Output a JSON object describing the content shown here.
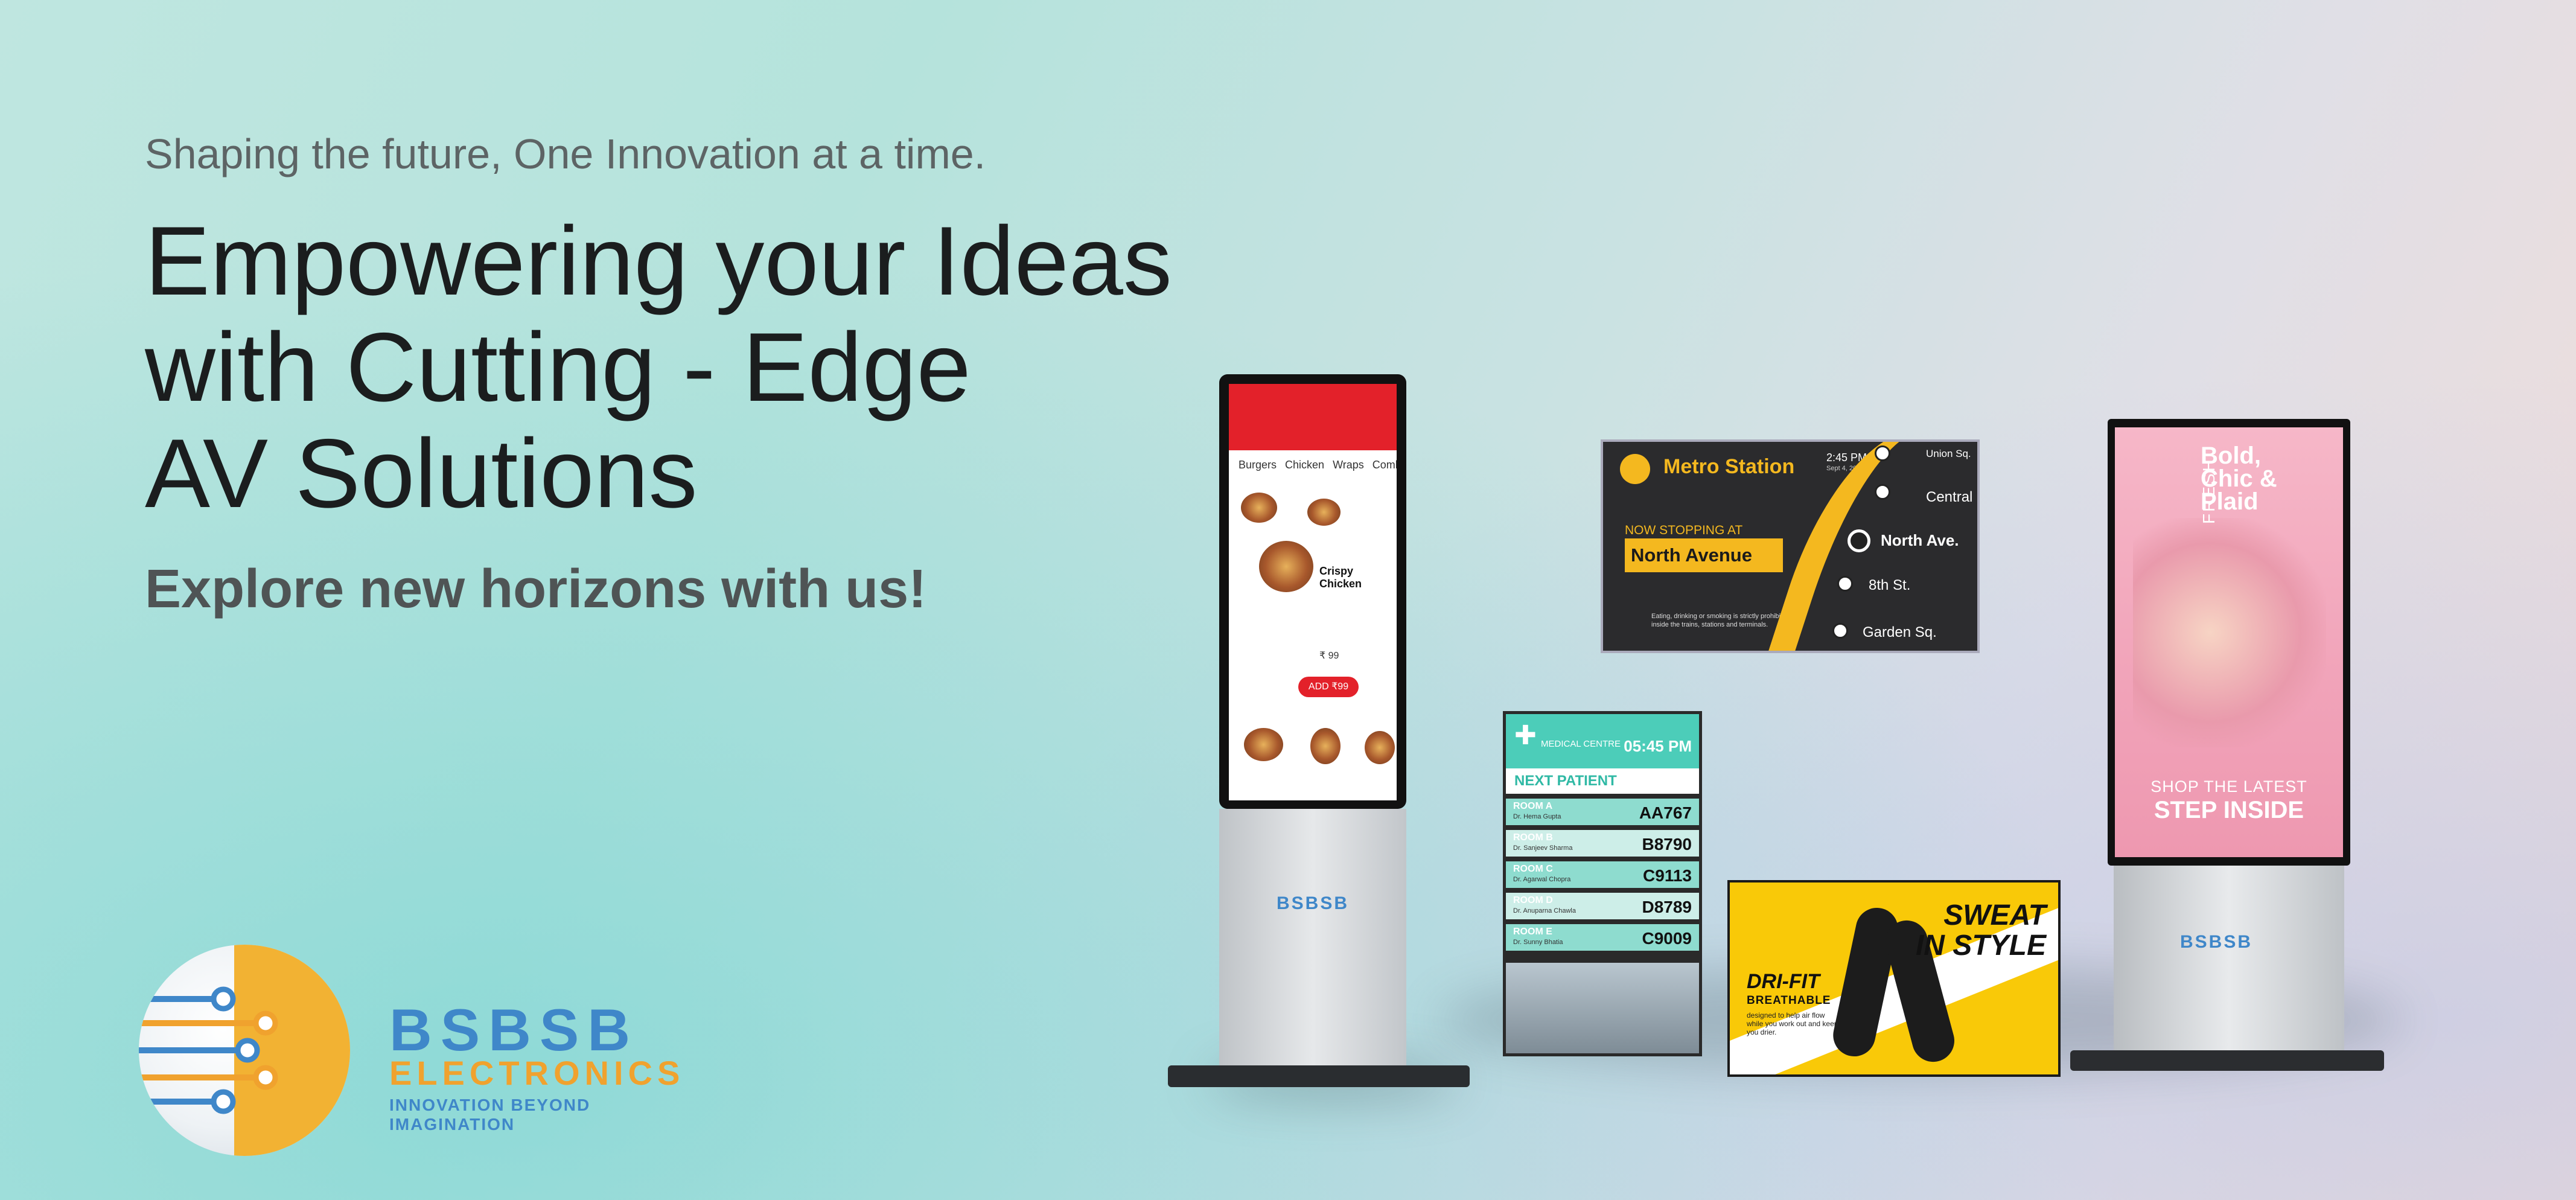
{
  "hero": {
    "tagline": "Shaping the future, One Innovation at a time.",
    "headline": [
      "Empowering your Ideas",
      "with Cutting - Edge",
      "AV Solutions"
    ],
    "subheadline": "Explore new horizons with us!"
  },
  "brand": {
    "name": "BSBSB",
    "sub": "ELECTRONICS",
    "tagline": "INNOVATION BEYOND IMAGINATION",
    "colors": {
      "blue": "#3f87c9",
      "orange": "#f0a22e"
    }
  },
  "kiosk_food": {
    "tabs": [
      "Burgers",
      "Chicken",
      "Wraps",
      "Combos"
    ],
    "item_title": "Crispy Chicken",
    "price": "₹ 99",
    "add_button": "ADD ₹99"
  },
  "metro": {
    "title": "Metro Station",
    "time": "2:45 PM",
    "date": "Sept 4, 2022",
    "stopping_label": "NOW STOPPING AT",
    "stop": "North Avenue",
    "note": "Eating, drinking or smoking is strictly prohibited inside the trains, stations and terminals.",
    "stations": [
      "Union Sq.",
      "Central",
      "North Ave.",
      "8th St.",
      "Garden Sq."
    ]
  },
  "medical": {
    "centre": "MEDICAL CENTRE",
    "time": "05:45 PM",
    "next_label": "NEXT PATIENT",
    "rows": [
      {
        "room": "ROOM A",
        "doctor": "Dr. Hema Gupta",
        "code": "AA767"
      },
      {
        "room": "ROOM B",
        "doctor": "Dr. Sanjeev Sharma",
        "code": "B8790"
      },
      {
        "room": "ROOM C",
        "doctor": "Dr. Agarwal Chopra",
        "code": "C9113"
      },
      {
        "room": "ROOM D",
        "doctor": "Dr. Anuparna Chawla",
        "code": "D8789"
      },
      {
        "room": "ROOM E",
        "doctor": "Dr. Sunny Bhatia",
        "code": "C9009"
      }
    ]
  },
  "sport": {
    "headline": [
      "SWEAT",
      "IN STYLE"
    ],
    "product": "DRI-FIT",
    "product_sub": "BREATHABLE",
    "desc": "designed to help air flow while you work out and keep you drier."
  },
  "fashion": {
    "fresh": "FRESH",
    "headline": [
      "Bold,",
      "Chic &",
      "Plaid"
    ],
    "shop": "SHOP THE LATEST",
    "cta": "STEP INSIDE"
  }
}
